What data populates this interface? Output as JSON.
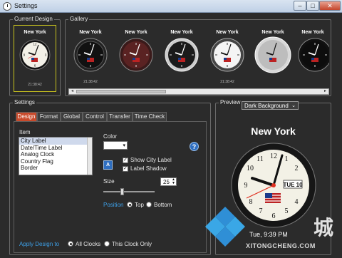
{
  "window": {
    "title": "Settings"
  },
  "current_design": {
    "label": "Current Design",
    "city": "New York",
    "time_small": "21:38:42"
  },
  "gallery": {
    "label": "Gallery",
    "items": [
      {
        "city": "New York",
        "time_small": "21:38:42"
      },
      {
        "city": "New York",
        "time_small": ""
      },
      {
        "city": "New York",
        "time_small": ""
      },
      {
        "city": "New York",
        "time_small": "21:38:42"
      },
      {
        "city": "New York",
        "time_small": ""
      },
      {
        "city": "New York",
        "time_small": ""
      }
    ]
  },
  "settings": {
    "label": "Settings",
    "tabs": [
      "Design",
      "Format",
      "Global",
      "Control",
      "Transfer",
      "Time Check"
    ],
    "item_label": "Item",
    "items": [
      "City Label",
      "Date/Time Label",
      "Analog Clock",
      "Country Flag",
      "Border"
    ],
    "color_label": "Color",
    "show_city_label": "Show City Label",
    "label_shadow": "Label Shadow",
    "size_label": "Size",
    "size_value": "25",
    "position_label": "Position",
    "position_top": "Top",
    "position_bottom": "Bottom",
    "apply_label": "Apply Design to",
    "apply_all": "All Clocks",
    "apply_this": "This Clock Only"
  },
  "preview": {
    "label": "Preview",
    "background_option": "Dark Background",
    "city": "New York",
    "date_badge": "TUE 10",
    "time_text": "Tue, 9:39 PM"
  },
  "watermark": {
    "char": "城",
    "site": "XITONGCHENG.COM"
  },
  "colors": {
    "tab_active": "#c94a2b",
    "accent_blue": "#3da0e8",
    "panel": "#2b2b2b"
  }
}
